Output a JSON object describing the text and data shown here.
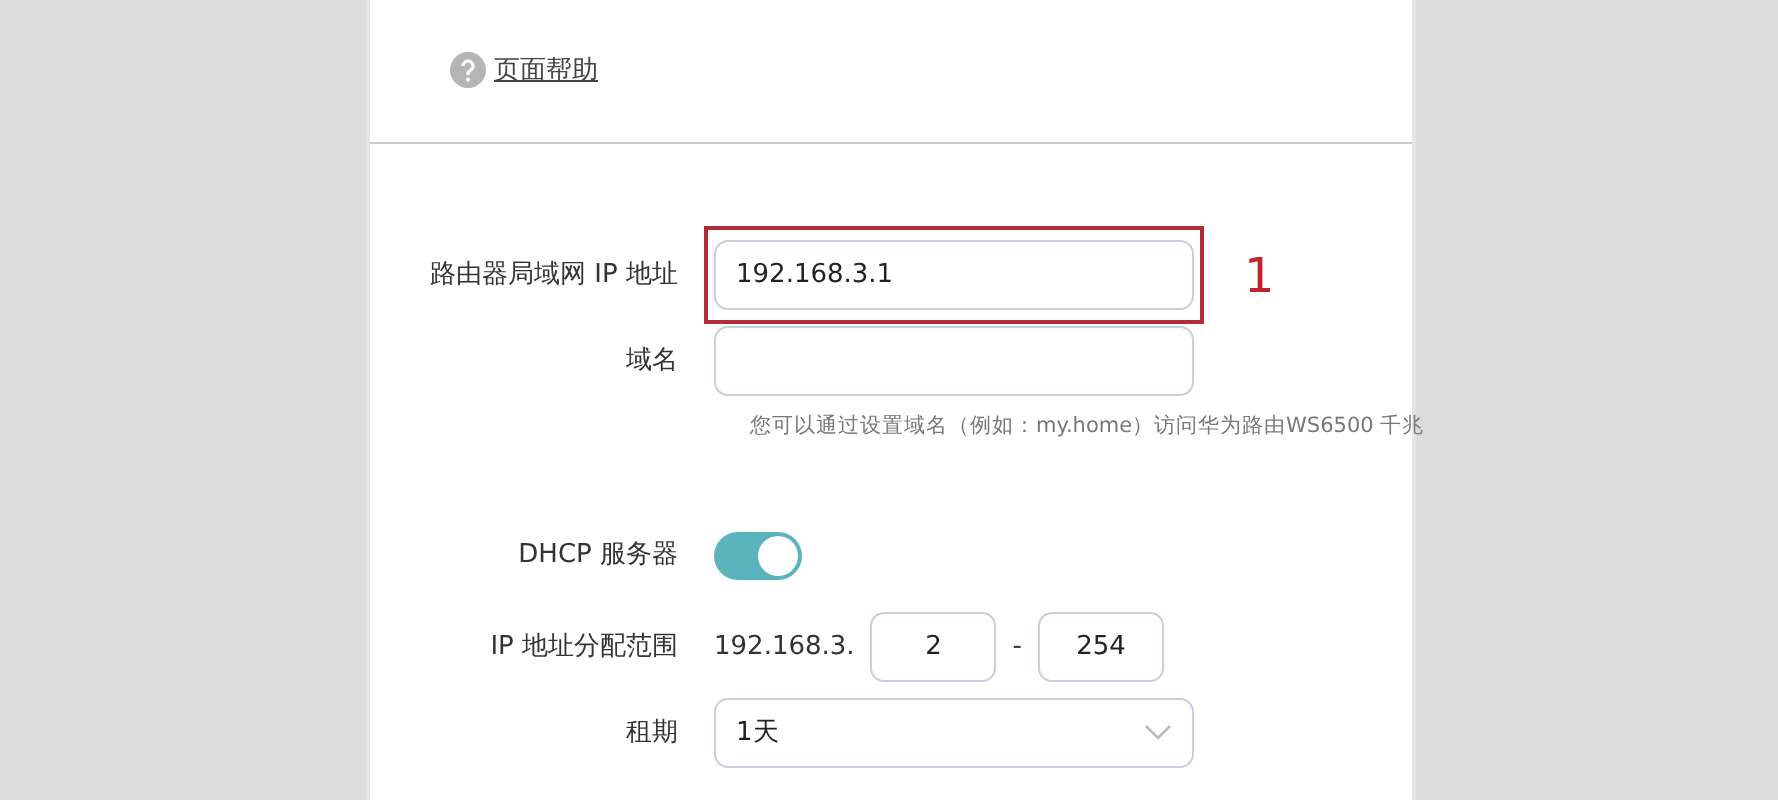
{
  "help_link": {
    "label": "页面帮助"
  },
  "lan": {
    "ip_label": "路由器局域网 IP 地址",
    "ip_value": "192.168.3.1",
    "highlighted": true,
    "annotation": "1",
    "domain_label": "域名",
    "hint": "您可以通过设置域名（例如：my.home）访问华为路由WS6500 千兆"
  },
  "dhcp": {
    "label": "DHCP 服务器",
    "on": true,
    "range_label": "IP 地址分配范围",
    "range_prefix": "192.168.3.",
    "range_start": "2",
    "range_separator": "-",
    "range_end": "254",
    "lease_label": "租期",
    "lease_value": "1天"
  }
}
